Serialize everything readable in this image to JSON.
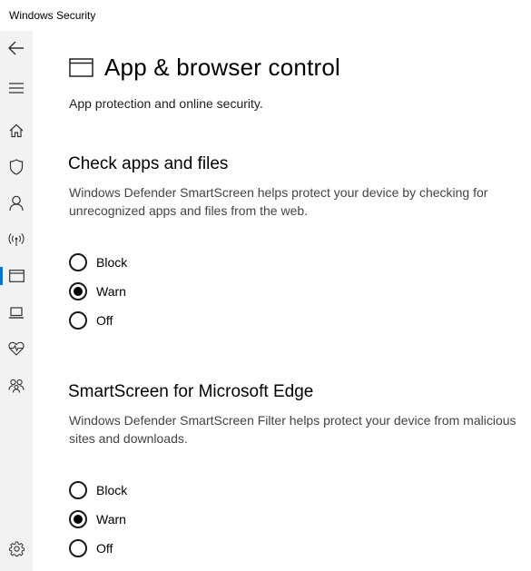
{
  "window": {
    "title": "Windows Security"
  },
  "sidebar": {
    "items": [
      {
        "name": "back",
        "icon": "back-arrow-icon"
      },
      {
        "name": "menu",
        "icon": "hamburger-icon"
      },
      {
        "name": "home",
        "icon": "home-icon"
      },
      {
        "name": "virus-protection",
        "icon": "shield-icon"
      },
      {
        "name": "account-protection",
        "icon": "person-icon"
      },
      {
        "name": "firewall-network",
        "icon": "wireless-icon"
      },
      {
        "name": "app-browser-control",
        "icon": "browser-window-icon",
        "active": true
      },
      {
        "name": "device-security",
        "icon": "laptop-icon"
      },
      {
        "name": "device-performance",
        "icon": "heart-pulse-icon"
      },
      {
        "name": "family-options",
        "icon": "family-icon"
      },
      {
        "name": "settings",
        "icon": "gear-icon"
      }
    ],
    "accent": "#0078d7"
  },
  "page": {
    "title": "App & browser control",
    "subtitle": "App protection and online security.",
    "header_icon": "browser-window-icon"
  },
  "sections": [
    {
      "title": "Check apps and files",
      "description": "Windows Defender SmartScreen helps protect your device by checking for unrecognized apps and files from the web.",
      "options": [
        "Block",
        "Warn",
        "Off"
      ],
      "selected": "Warn"
    },
    {
      "title": "SmartScreen for Microsoft Edge",
      "description": "Windows Defender SmartScreen Filter helps protect your device from malicious sites and downloads.",
      "options": [
        "Block",
        "Warn",
        "Off"
      ],
      "selected": "Warn"
    }
  ]
}
